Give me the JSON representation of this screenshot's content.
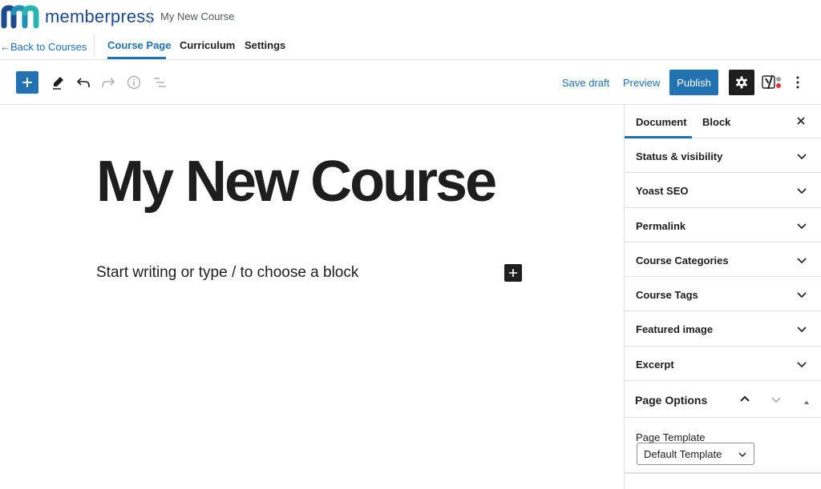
{
  "header": {
    "brand": "memberpress",
    "course_name": "My New Course",
    "back_link": "←Back to Courses",
    "tabs": [
      {
        "label": "Course Page",
        "active": true
      },
      {
        "label": "Curriculum",
        "active": false
      },
      {
        "label": "Settings",
        "active": false
      }
    ]
  },
  "toolbar": {
    "add_block_icon": "plus-icon",
    "tools": [
      "pencil-icon",
      "undo-icon",
      "redo-icon",
      "info-icon",
      "list-view-icon"
    ],
    "save_draft": "Save draft",
    "preview": "Preview",
    "publish": "Publish",
    "settings_icon": "gear-icon",
    "yoast_icon": "yoast-icon",
    "more_icon": "more-vertical-icon"
  },
  "editor": {
    "title": "My New Course",
    "placeholder": "Start writing or type / to choose a block"
  },
  "sidebar": {
    "tabs": [
      {
        "label": "Document",
        "active": true
      },
      {
        "label": "Block",
        "active": false
      }
    ],
    "close_icon": "close-icon",
    "panels": [
      {
        "label": "Status & visibility"
      },
      {
        "label": "Yoast SEO"
      },
      {
        "label": "Permalink"
      },
      {
        "label": "Course Categories"
      },
      {
        "label": "Course Tags"
      },
      {
        "label": "Featured image"
      },
      {
        "label": "Excerpt"
      }
    ],
    "page_options": {
      "title": "Page Options",
      "template_label": "Page Template",
      "template_value": "Default Template"
    }
  },
  "colors": {
    "accent": "#2271b1",
    "dark": "#1e1e1e",
    "border": "#e0e0e0"
  }
}
